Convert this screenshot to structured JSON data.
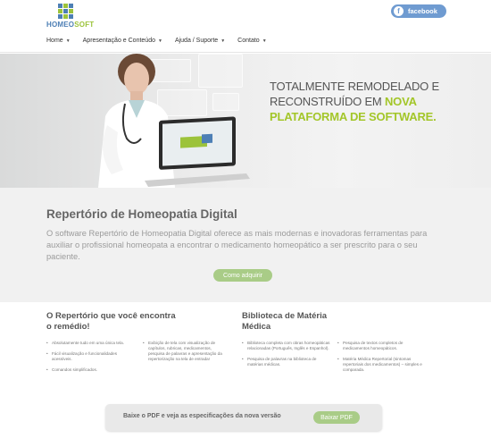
{
  "logo": {
    "part1": "HOMEO",
    "part2": "SOFT",
    "grid_colors": [
      "#4d7fb5",
      "#9cc33b",
      "#4d7fb5",
      "#9cc33b",
      "#4d7fb5",
      "#9cc33b",
      "#4d7fb5",
      "#9cc33b",
      "#4d7fb5"
    ]
  },
  "social": {
    "label": "facebook",
    "icon": "f"
  },
  "nav": [
    {
      "label": "Home"
    },
    {
      "label": "Apresentação e Conteúdo"
    },
    {
      "label": "Ajuda / Suporte"
    },
    {
      "label": "Contato"
    }
  ],
  "banner": {
    "line1": "Totalmente remodelado e",
    "line2a": "reconstruído em ",
    "line2b": "nova",
    "line3": "plataforma de software",
    "line3_end": "."
  },
  "main": {
    "title": "Repertório de Homeopatia Digital",
    "text": "O software Repertório de Homeopatia Digital oferece as mais modernas e inovadoras ferramentas para auxiliar o profissional homeopata a encontrar o medicamento homeopático a ser prescrito para o seu paciente.",
    "cta": "Como adquirir"
  },
  "repertorio": {
    "title": "O Repertório que você encontra o remédio!",
    "col1": [
      "Absolutamente tudo em uma única tela.",
      "Fácil visualização e funcionalidades acessíveis.",
      "Comandos simplificados."
    ],
    "col2": [
      "Exibição de tela com visualização de capítulos, rubricas, medicamentos, pesquisa de palavras e apresentação da repertorização na tela de entrada!"
    ]
  },
  "biblioteca": {
    "title": "Biblioteca de Matéria Médica",
    "col1": [
      "Biblioteca completa com obras homeopáticas relacionadas (Português, Inglês e Espanhol).",
      "Pesquisa de palavras na biblioteca de matérias médicas."
    ],
    "col2": [
      "Pesquisa de textos completos de medicamentos homeopáticos.",
      "Matéria Médica Repertorial (sintomas repertoriais dos medicamentos) – simples e comparada."
    ]
  },
  "pdf": {
    "text": "Baixe o PDF e veja as especificações da nova versão",
    "button": "Baixar PDF"
  },
  "colors": {
    "accent_green": "#a3c629",
    "button_green": "#a9cc87",
    "facebook_blue": "#6f9bd1"
  }
}
